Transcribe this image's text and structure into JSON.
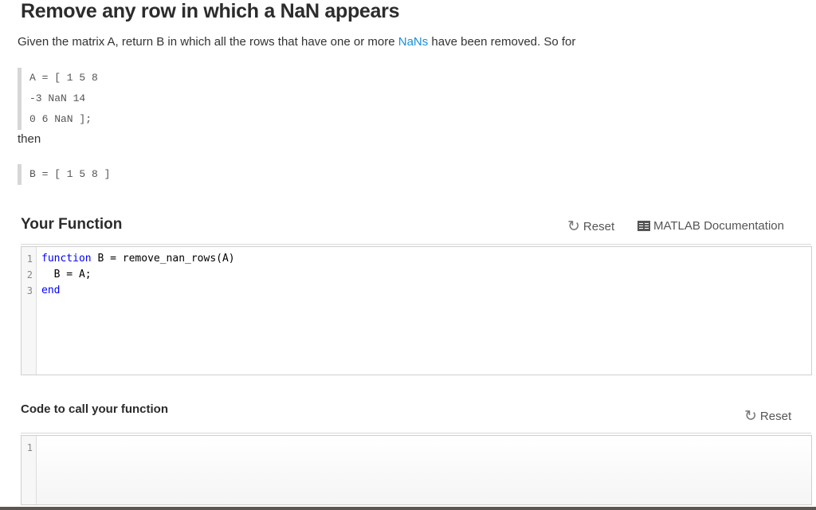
{
  "problem": {
    "title": "Remove any row in which a NaN appears",
    "description_before": "Given the matrix A, return B in which all the rows that have one or more ",
    "description_link": "NaNs",
    "description_after": " have been removed. So for",
    "example_a_lines": [
      "A = [ 1 5 8",
      "-3 NaN 14",
      "0 6 NaN ];"
    ],
    "then_label": "then",
    "example_b_lines": [
      "B = [ 1 5 8 ]"
    ]
  },
  "your_function": {
    "title": "Your Function",
    "reset_label": "Reset",
    "reset_icon": "refresh-icon",
    "doc_label": "MATLAB Documentation",
    "doc_icon": "book-icon",
    "line_numbers": [
      "1",
      "2",
      "3"
    ],
    "code_lines": [
      {
        "keyword": "function",
        "rest": " B = remove_nan_rows(A)"
      },
      {
        "keyword": "",
        "rest": "  B = A;"
      },
      {
        "keyword": "end",
        "rest": ""
      }
    ]
  },
  "call_function": {
    "title": "Code to call your function",
    "reset_label": "Reset",
    "reset_icon": "refresh-icon",
    "line_numbers": [
      "1"
    ],
    "code_lines": [
      ""
    ]
  },
  "colors": {
    "link": "#1a8ed8",
    "keyword": "#0000ff"
  }
}
